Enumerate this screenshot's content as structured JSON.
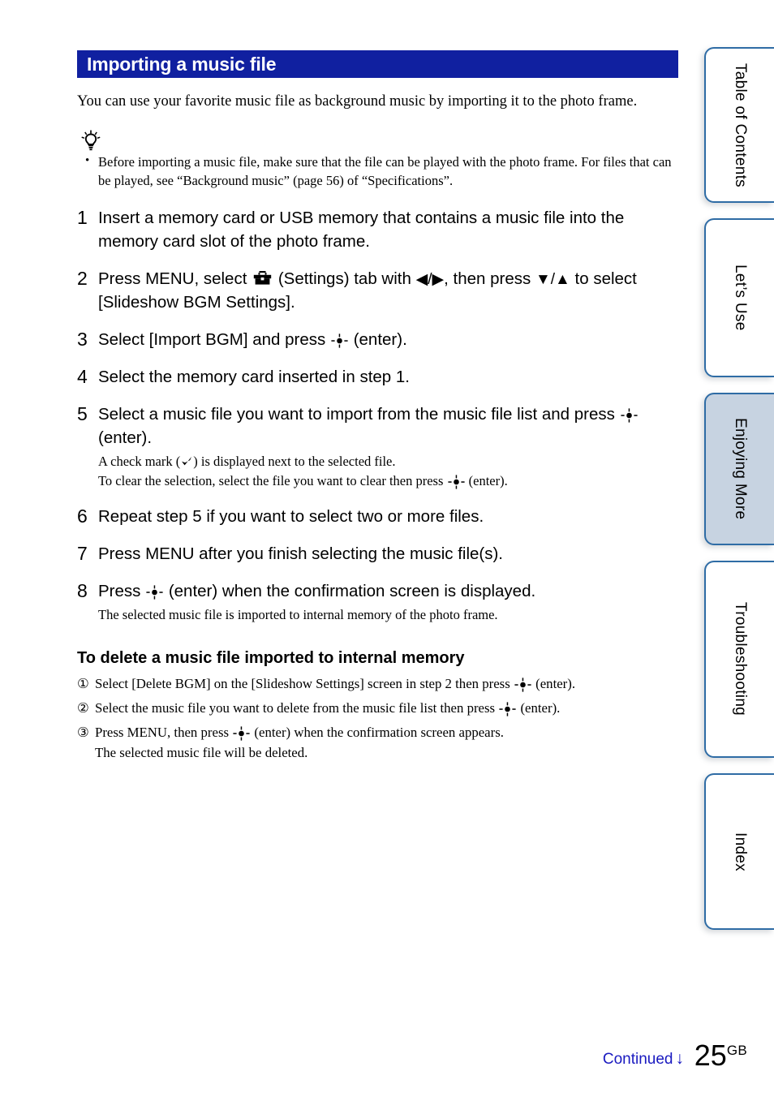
{
  "header": {
    "title": "Importing a music file",
    "bar_color": "#1020a0"
  },
  "intro": "You can use your favorite music file as background music by importing it to the photo frame.",
  "tip": {
    "icon": "lightbulb-tip-icon",
    "items": [
      "Before importing a music file, make sure that the file can be played with the photo frame. For files that can be played, see “Background music” (page 56) of “Specifications”."
    ]
  },
  "steps": [
    {
      "num": "1",
      "text": "Insert a memory card or USB memory that contains a music file into the memory card slot of the photo frame.",
      "sub": ""
    },
    {
      "num": "2",
      "text_a": "Press MENU, select",
      "text_b": "(Settings) tab with",
      "arrows_lr": "◀/▶",
      "text_c": ", then press",
      "arrows_ud": "▼/▲",
      "text_d": "to select [Slideshow BGM Settings]."
    },
    {
      "num": "3",
      "text_a": "Select [Import BGM] and press",
      "text_b": "(enter)."
    },
    {
      "num": "4",
      "text": "Select the memory card inserted in step 1."
    },
    {
      "num": "5",
      "text_a": "Select a music file you want to import from the music file list and press",
      "text_b": "(enter).",
      "sub_a": "A check mark (",
      "sub_b": ") is displayed next to the selected file.",
      "sub_c": "To clear the selection, select the file you want to clear then press",
      "sub_d": "(enter)."
    },
    {
      "num": "6",
      "text": "Repeat step 5 if you want to select two or more files."
    },
    {
      "num": "7",
      "text": "Press MENU after you finish selecting the music file(s)."
    },
    {
      "num": "8",
      "text_a": "Press",
      "text_b": "(enter) when the confirmation screen is displayed.",
      "sub": "The selected music file is imported to internal memory of the photo frame."
    }
  ],
  "delete_section": {
    "heading": "To delete a music file imported to internal memory",
    "items": [
      {
        "num": "①",
        "text_a": "Select [Delete BGM] on the [Slideshow Settings] screen in step 2 then press",
        "text_b": "(enter)."
      },
      {
        "num": "②",
        "text_a": "Select the music file you want to delete from the music file list then press",
        "text_b": "(enter)."
      },
      {
        "num": "③",
        "text_a": "Press MENU, then press",
        "text_b": "(enter) when the confirmation screen appears.",
        "text_c": "The selected music file will be deleted."
      }
    ]
  },
  "tabs": [
    {
      "label": "Table of Contents",
      "active": false
    },
    {
      "label": "Let’s Use",
      "active": false
    },
    {
      "label": "Enjoying More",
      "active": true
    },
    {
      "label": "Troubleshooting",
      "active": false
    },
    {
      "label": "Index",
      "active": false
    }
  ],
  "footer": {
    "continued": "Continued",
    "continued_arrow": "↓",
    "continued_color": "#1a1ac0",
    "page_number": "25",
    "page_suffix": "GB"
  }
}
